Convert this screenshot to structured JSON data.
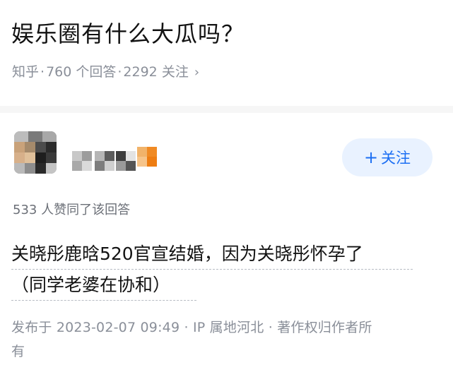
{
  "question": {
    "title": "娱乐圈有什么大瓜吗？",
    "meta": {
      "source": "知乎",
      "answers": "760 个回答",
      "followers": "2292 关注",
      "chevron": "›"
    }
  },
  "answer": {
    "author_name": "",
    "follow_button": {
      "plus": "+",
      "label": "关注"
    },
    "upvote_text": "533 人赞同了该回答",
    "content_lines": [
      "关晓彤鹿晗520官宣结婚，因为关晓彤怀孕了",
      "（同学老婆在协和）"
    ],
    "footer_line1": "发布于 2023-02-07 09:49 · IP 属地河北 · 著作权归作者所",
    "footer_line2": "有"
  },
  "colors": {
    "accent": "#1b6ef3",
    "follow_bg": "#e9f2ff",
    "meta_gray": "#8a8f99",
    "divider": "#f6f6f6"
  },
  "icons": {
    "meta_chevron": "chevron-right-icon",
    "follow_plus": "plus-icon"
  }
}
